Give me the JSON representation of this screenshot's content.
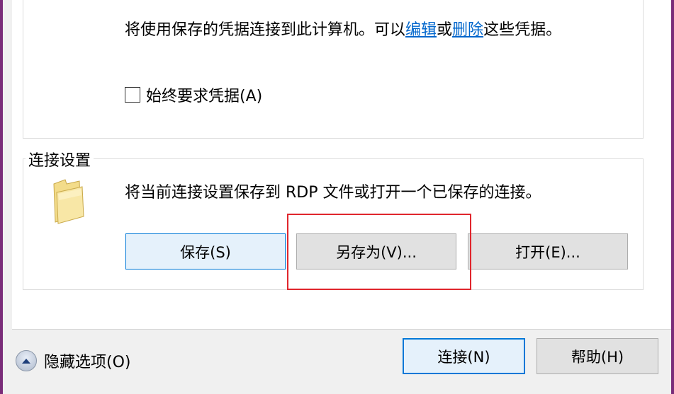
{
  "credentials": {
    "text_before": "将使用保存的凭据连接到此计算机。可以",
    "edit_link": "编辑",
    "or_text": "或",
    "delete_link": "删除",
    "text_after": "这些凭据。",
    "always_ask_label": "始终要求凭据(A)",
    "always_ask_checked": false
  },
  "connection_settings": {
    "title": "连接设置",
    "description": "将当前连接设置保存到 RDP 文件或打开一个已保存的连接。",
    "folder_icon": "folder-icon",
    "save_label": "保存(S)",
    "save_as_label": "另存为(V)...",
    "open_label": "打开(E)..."
  },
  "footer": {
    "hide_options_label": "隐藏选项(O)",
    "hide_options_icon": "chevron-up-icon",
    "connect_label": "连接(N)",
    "help_label": "帮助(H)"
  },
  "colors": {
    "link": "#0066cc",
    "highlight_border": "#e0262d",
    "focus_border": "#0078d7",
    "window_frame": "#7a2c79"
  }
}
